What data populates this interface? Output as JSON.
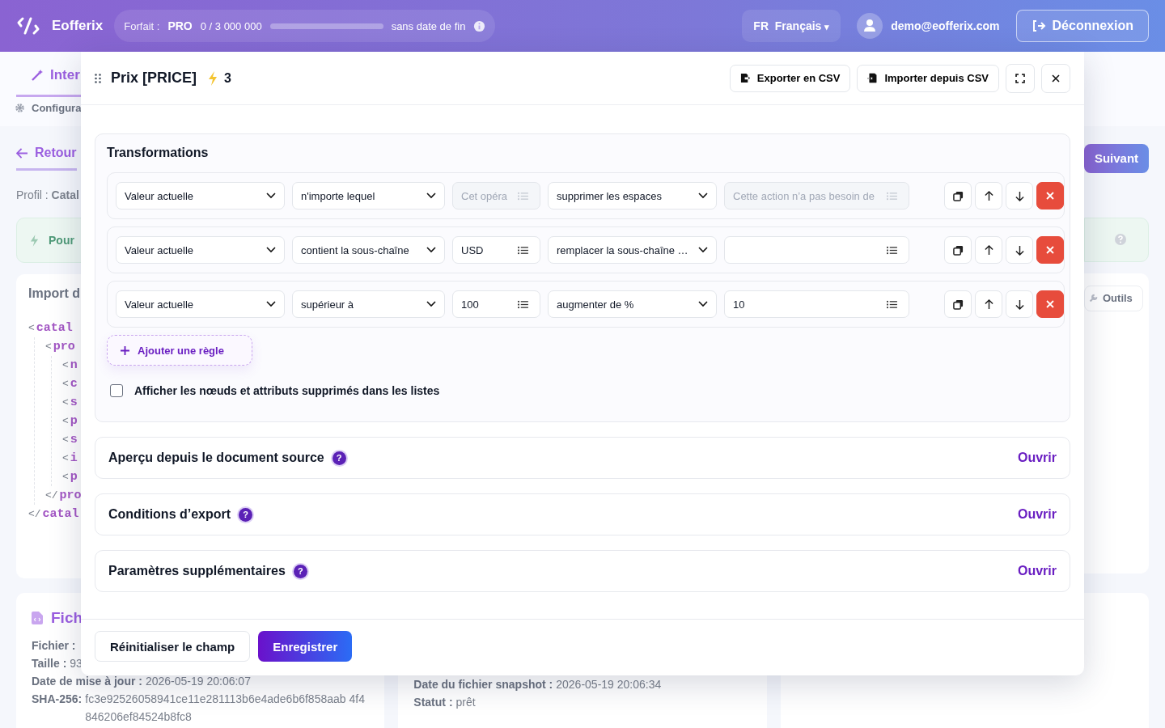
{
  "header": {
    "brand": "Eofferix",
    "plan": {
      "label": "Forfait :",
      "name": "PRO",
      "usage": "0 / 3 000 000",
      "level": 0,
      "expiry": "sans date de fin"
    },
    "language": {
      "code": "FR",
      "name": "Français",
      "caret": "▾"
    },
    "user": {
      "email": "demo@eofferix.com"
    },
    "logout": "Déconnexion"
  },
  "tabs": [
    {
      "label": "Inter",
      "selected": true
    }
  ],
  "subtab": "Configura",
  "back": "Retour",
  "profile": {
    "label": "Profil :",
    "value": "Catal"
  },
  "alert": "Pour",
  "import_card": {
    "title": "Import d",
    "tree": [
      {
        "bracket": "<",
        "tag": "catal",
        "children": [
          {
            "bracket": "<",
            "tag": "pro",
            "children": [
              {
                "bracket": "<",
                "tag": "n"
              },
              {
                "bracket": "<",
                "tag": "c"
              },
              {
                "bracket": "<",
                "tag": "s"
              },
              {
                "bracket": "<",
                "tag": "p"
              },
              {
                "bracket": "<",
                "tag": "s"
              },
              {
                "bracket": "<",
                "tag": "i"
              },
              {
                "bracket": "<",
                "tag": "p"
              }
            ],
            "closing": {
              "bracket": "</",
              "tag": "pro"
            }
          }
        ],
        "closing": {
          "bracket": "</",
          "tag": "catal"
        }
      }
    ]
  },
  "info_cards": [
    {
      "title": "Fich",
      "lines": [
        {
          "label": "Fichier :"
        },
        {
          "label": "Taille :",
          "value": "93"
        },
        {
          "label": "Date de mise à jour :",
          "value": "2026-05-19 20:06:07"
        },
        {
          "label": "SHA-256:",
          "value": "fc3e92526058941ce11e281113b6e4ade6b6f858aab 4f4846206ef84524b8fc8"
        }
      ]
    },
    {
      "lines": [
        {
          "label": "Date du fichier snapshot :",
          "value": "2026-05-19 20:06:34"
        },
        {
          "label": "Statut :",
          "value": "prêt"
        }
      ]
    }
  ],
  "next": "Suivant",
  "tools": "Outils",
  "modal": {
    "title": "Prix [PRICE]",
    "badge": "3",
    "actions": [
      "Exporter en CSV",
      "Importer depuis CSV"
    ],
    "section_title": "Transformations",
    "rules": [
      {
        "source": "Valeur actuelle",
        "condition": "n'importe lequel",
        "value": {
          "placeholder": "Cet opéra",
          "disabled": true
        },
        "action": "supprimer les espaces",
        "action_value": {
          "placeholder": "Cette action n’a pas besoin de",
          "disabled": true
        }
      },
      {
        "source": "Valeur actuelle",
        "condition": "contient la sous-chaîne",
        "value": {
          "text": "USD",
          "disabled": false
        },
        "action": "remplacer la sous-chaîne …",
        "action_value": {
          "disabled": false
        }
      },
      {
        "source": "Valeur actuelle",
        "condition": "supérieur à",
        "value": {
          "text": "100",
          "disabled": false
        },
        "action": "augmenter de %",
        "action_value": {
          "text": "10",
          "disabled": false
        }
      }
    ],
    "add_rule": "Ajouter une règle",
    "checkbox": {
      "label": "Afficher les nœuds et attributs supprimés dans les listes",
      "checked": false
    },
    "panels": [
      {
        "title": "Aperçu depuis le document source",
        "help": "?",
        "action": "Ouvrir"
      },
      {
        "title": "Conditions d’export",
        "help": "?",
        "action": "Ouvrir"
      },
      {
        "title": "Paramètres supplémentaires",
        "help": "?",
        "action": "Ouvrir"
      }
    ],
    "footer": [
      "Réinitialiser le champ",
      "Enregistrer"
    ]
  }
}
